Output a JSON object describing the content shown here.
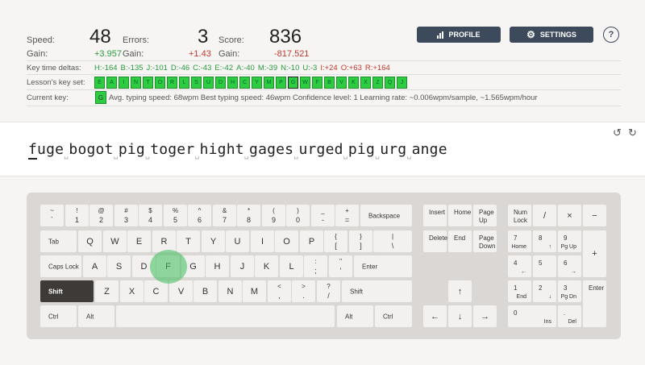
{
  "stats": {
    "speed_label": "Speed:",
    "speed": "48",
    "errors_label": "Errors:",
    "errors": "3",
    "score_label": "Score:",
    "score": "836",
    "gain_label": "Gain:",
    "speed_gain": "+3.957",
    "errors_gain": "+1.43",
    "score_gain": "-817.521"
  },
  "buttons": {
    "profile": "PROFILE",
    "settings": "SETTINGS",
    "help": "?"
  },
  "deltas": {
    "label": "Key time deltas:",
    "items": [
      {
        "t": "H:-164",
        "c": "pos"
      },
      {
        "t": "B:-135",
        "c": "pos"
      },
      {
        "t": "J:-101",
        "c": "pos"
      },
      {
        "t": "D:-46",
        "c": "pos"
      },
      {
        "t": "C:-43",
        "c": "pos"
      },
      {
        "t": "E:-42",
        "c": "pos"
      },
      {
        "t": "A:-40",
        "c": "pos"
      },
      {
        "t": "M:-39",
        "c": "pos"
      },
      {
        "t": "N:-10",
        "c": "pos"
      },
      {
        "t": "U:-3",
        "c": "pos"
      },
      {
        "t": "I:+24",
        "c": "neg"
      },
      {
        "t": "O:+63",
        "c": "neg"
      },
      {
        "t": "R:+164",
        "c": "neg"
      }
    ]
  },
  "keyset": {
    "label": "Lesson's key set:",
    "keys": [
      "E",
      "A",
      "I",
      "N",
      "T",
      "O",
      "R",
      "L",
      "S",
      "U",
      "D",
      "H",
      "C",
      "Y",
      "M",
      "P",
      "G",
      "W",
      "F",
      "B",
      "V",
      "K",
      "X",
      "Z",
      "Q",
      "J"
    ],
    "current_index": 16
  },
  "current": {
    "label": "Current key:",
    "key": "G",
    "info": "Avg. typing speed: 68wpm Best typing speed: 46wpm Confidence level: 1 Learning rate: ~0.006wpm/sample, ~1.565wpm/hour"
  },
  "lesson": {
    "words": [
      "fuge",
      "bogot",
      "pig",
      "toger",
      "hight",
      "gages",
      "urged",
      "pig",
      "urg",
      "ange"
    ],
    "space_glyph": "␣"
  },
  "controls": {
    "reset": "↺",
    "redo": "↻"
  }
}
